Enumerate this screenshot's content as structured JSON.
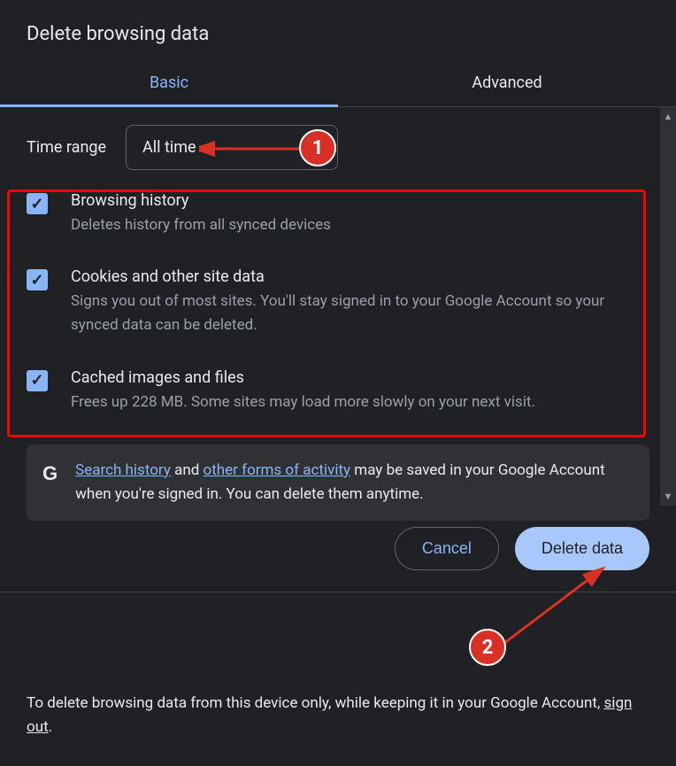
{
  "title": "Delete browsing data",
  "tabs": {
    "basic": "Basic",
    "advanced": "Advanced"
  },
  "time": {
    "label": "Time range",
    "value": "All time"
  },
  "options": [
    {
      "title": "Browsing history",
      "desc": "Deletes history from all synced devices"
    },
    {
      "title": "Cookies and other site data",
      "desc": "Signs you out of most sites. You'll stay signed in to your Google Account so your synced data can be deleted."
    },
    {
      "title": "Cached images and files",
      "desc": "Frees up 228 MB. Some sites may load more slowly on your next visit."
    }
  ],
  "notice": {
    "link1": "Search history",
    "middle": " and ",
    "link2": "other forms of activity",
    "rest": " may be saved in your Google Account when you're signed in. You can delete them anytime."
  },
  "buttons": {
    "cancel": "Cancel",
    "confirm": "Delete data"
  },
  "footer": {
    "text": "To delete browsing data from this device only, while keeping it in your Google Account, ",
    "link": "sign out",
    "trail": "."
  },
  "annotations": {
    "one": "1",
    "two": "2"
  }
}
